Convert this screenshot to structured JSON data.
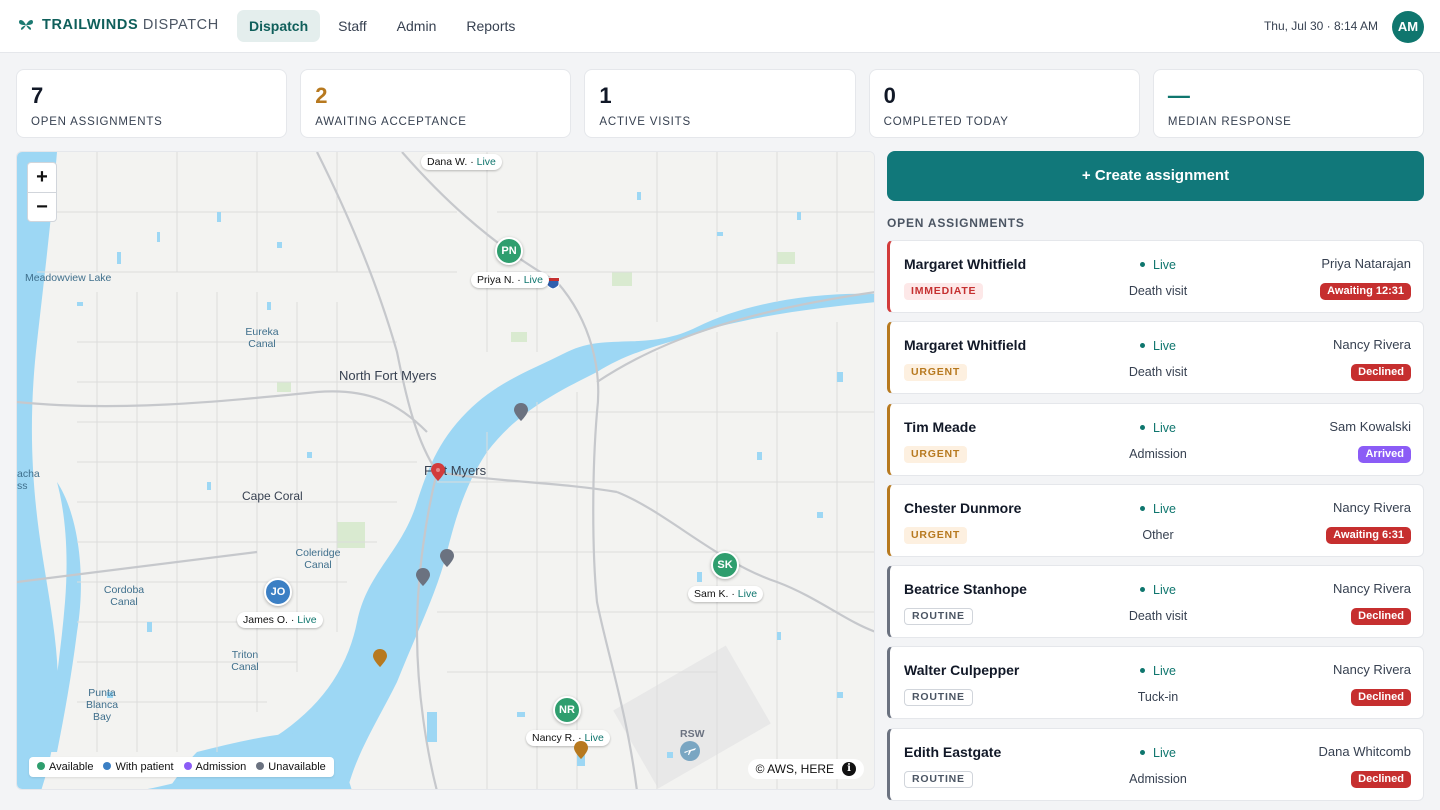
{
  "app": {
    "brand_bold": "TRAILWINDS",
    "brand_light": "DISPATCH",
    "datetime": "Thu, Jul 30 · 8:14 AM",
    "user_initials": "AM",
    "tabs": [
      {
        "label": "Dispatch",
        "active": true
      },
      {
        "label": "Staff",
        "active": false
      },
      {
        "label": "Admin",
        "active": false
      },
      {
        "label": "Reports",
        "active": false
      }
    ]
  },
  "stats": [
    {
      "value": "7",
      "label": "OPEN ASSIGNMENTS",
      "color": "#111827"
    },
    {
      "value": "2",
      "label": "AWAITING ACCEPTANCE",
      "color": "#b7791f"
    },
    {
      "value": "1",
      "label": "ACTIVE VISITS",
      "color": "#111827"
    },
    {
      "value": "0",
      "label": "COMPLETED TODAY",
      "color": "#111827"
    },
    {
      "value": "—",
      "label": "MEDIAN RESPONSE",
      "color": "#0f766e"
    }
  ],
  "map": {
    "zoom_in": "+",
    "zoom_out": "−",
    "places": {
      "north_fort_myers": "North Fort Myers",
      "fort_myers": "Fort Myers",
      "cape_coral": "Cape Coral",
      "meadowview": "Meadowview Lake",
      "eureka": "Eureka Canal",
      "coleridge": "Coleridge Canal",
      "cordoba": "Cordoba Canal",
      "triton": "Triton Canal",
      "punta": "Punta Blanca Bay",
      "rsw": "RSW",
      "macha": "acha ss"
    },
    "staff": [
      {
        "initials": "PN",
        "label": "Priya N.",
        "color": "#2f9e6e"
      },
      {
        "initials": "SK",
        "label": "Sam K.",
        "color": "#2f9e6e"
      },
      {
        "initials": "JO",
        "label": "James O.",
        "color": "#3b7fc4"
      },
      {
        "initials": "NR",
        "label": "Nancy R.",
        "color": "#2f9e6e"
      },
      {
        "initials": "",
        "label": "Dana W.",
        "color": "#2f9e6e"
      }
    ],
    "live_text": "Live",
    "legend": [
      {
        "label": "Available",
        "color": "#2f9e6e"
      },
      {
        "label": "With patient",
        "color": "#3b7fc4"
      },
      {
        "label": "Admission",
        "color": "#8b5cf6"
      },
      {
        "label": "Unavailable",
        "color": "#6b7280"
      }
    ],
    "attribution": "© AWS, HERE",
    "info_glyph": "i"
  },
  "panel": {
    "create_label": "+ Create assignment",
    "section_title": "OPEN ASSIGNMENTS",
    "live_text": "Live",
    "assignments": [
      {
        "patient": "Margaret Whitfield",
        "priority": "IMMEDIATE",
        "visit": "Death visit",
        "staff": "Priya Natarajan",
        "status": "Awaiting 12:31",
        "status_color": "#c62f2f"
      },
      {
        "patient": "Margaret Whitfield",
        "priority": "URGENT",
        "visit": "Death visit",
        "staff": "Nancy Rivera",
        "status": "Declined",
        "status_color": "#c62f2f"
      },
      {
        "patient": "Tim Meade",
        "priority": "URGENT",
        "visit": "Admission",
        "staff": "Sam Kowalski",
        "status": "Arrived",
        "status_color": "#8b5cf6"
      },
      {
        "patient": "Chester Dunmore",
        "priority": "URGENT",
        "visit": "Other",
        "staff": "Nancy Rivera",
        "status": "Awaiting 6:31",
        "status_color": "#c62f2f"
      },
      {
        "patient": "Beatrice Stanhope",
        "priority": "ROUTINE",
        "visit": "Death visit",
        "staff": "Nancy Rivera",
        "status": "Declined",
        "status_color": "#c62f2f"
      },
      {
        "patient": "Walter Culpepper",
        "priority": "ROUTINE",
        "visit": "Tuck-in",
        "staff": "Nancy Rivera",
        "status": "Declined",
        "status_color": "#c62f2f"
      },
      {
        "patient": "Edith Eastgate",
        "priority": "ROUTINE",
        "visit": "Admission",
        "staff": "Dana Whitcomb",
        "status": "Declined",
        "status_color": "#c62f2f"
      }
    ]
  }
}
